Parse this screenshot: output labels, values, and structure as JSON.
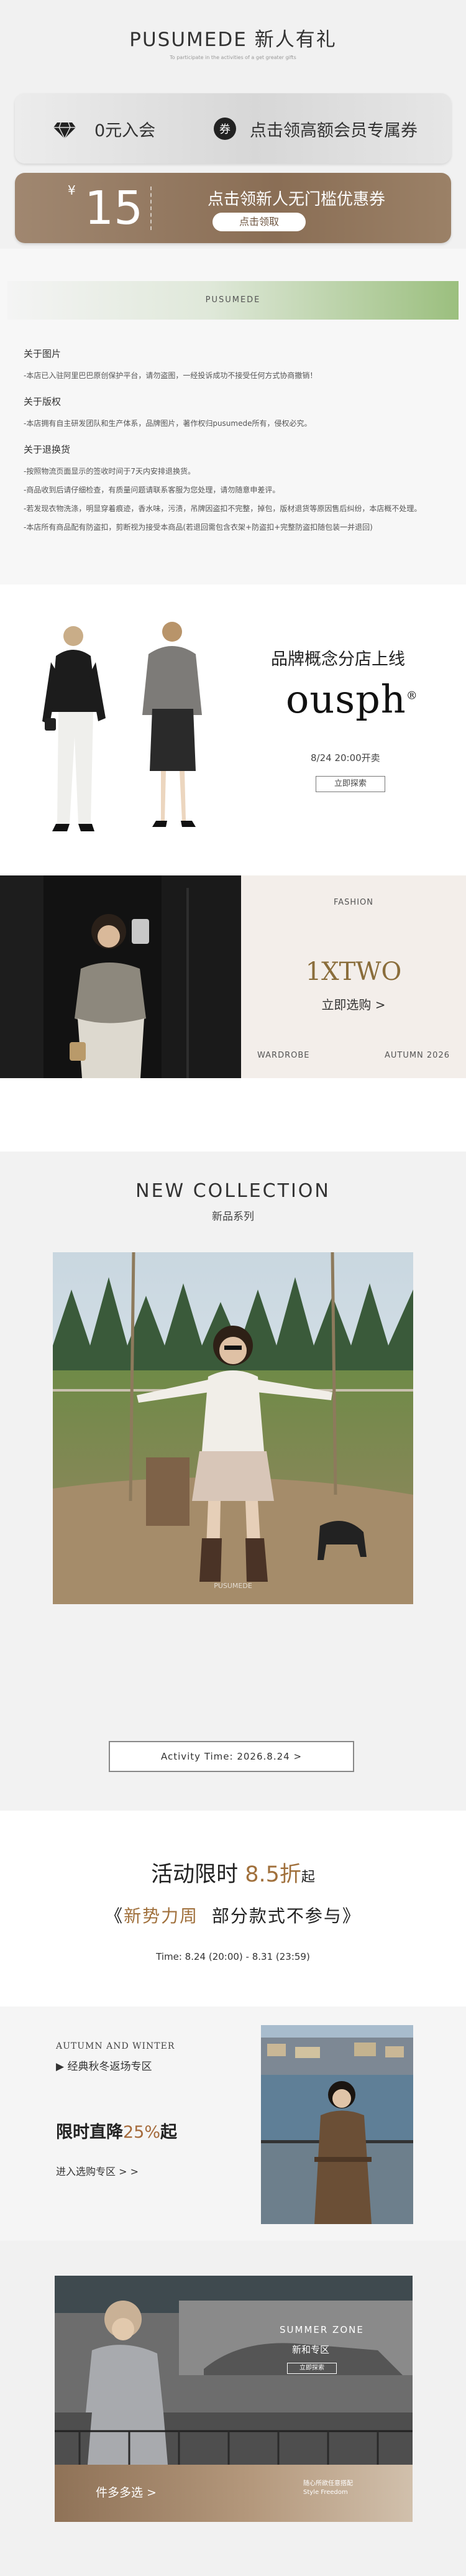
{
  "header": {
    "title": "PUSUMEDE 新人有礼",
    "subtitle": "To participate in the activities of a get greater gifts",
    "coupon1": {
      "left_label": "0元入会",
      "right_label": "点击领高额会员专属券"
    },
    "coupon2": {
      "currency": "¥",
      "amount": "15",
      "label": "点击领新人无门槛优惠券",
      "button": "点击领取"
    }
  },
  "notice": {
    "brand_bar": "PUSUMEDE",
    "sections": [
      {
        "heading": "关于图片",
        "lines": [
          "-本店已入驻阿里巴巴原创保护平台，请勿盗图，一经投诉成功不接受任何方式协商撤销！"
        ]
      },
      {
        "heading": "关于版权",
        "lines": [
          "-本店拥有自主研发团队和生产体系，品牌图片，著作权归pusumede所有，侵权必究。"
        ]
      },
      {
        "heading": "关于退换货",
        "lines": [
          "-按照物流页面显示的签收时间于7天内安排退换货。",
          "-商品收到后请仔细检查，有质量问题请联系客服为您处理，请勿随意申差评。",
          "-若发现衣物洗涤，明显穿着痕迹，香水味，污渍，吊牌因盗扣不完整，掉包，版材退货等原因售后纠纷，本店概不处理。",
          "-本店所有商品配有防盗扣，剪断视为接受本商品(若退回需包含衣架+防盗扣+完整防盗扣随包装一并退回)"
        ]
      }
    ]
  },
  "ousph": {
    "announcement": "品牌概念分店上线",
    "logo": "ousph",
    "logo_mark": "®",
    "date": "8/24 20:00开卖",
    "button": "立即探索"
  },
  "xtwo": {
    "tag": "FASHION",
    "brand": "1XTWO",
    "cta": "立即选购 >",
    "left_foot": "WARDROBE",
    "right_foot": "AUTUMN 2026"
  },
  "collection": {
    "title": "NEW COLLECTION",
    "subtitle": "新品系列",
    "activity": "Activity Time: 2026.8.24    >",
    "watermark": "PUSUMEDE"
  },
  "promo": {
    "line1_prefix": "活动限时",
    "line1_discount": "8.5折",
    "line1_suffix": "起",
    "line2_open": "《",
    "line2_highlight": "新势力周",
    "line2_rest": "部分款式不参与》",
    "time": "Time: 8.24 (20:00) - 8.31 (23:59)"
  },
  "autumn": {
    "eyebrow": "AUTUMN AND WINTER",
    "zone": "▶ 经典秋冬返场专区",
    "drop_prefix": "限时直降",
    "drop_value": "25%",
    "drop_suffix": "起",
    "enter": "进入选购专区 > >"
  },
  "summer": {
    "zone": "SUMMER ZONE",
    "zone_cn": "新和专区",
    "button": "立即探索",
    "more": "件多多选 >",
    "notes": [
      "随心所欲任意搭配",
      "Style Freedom"
    ]
  }
}
